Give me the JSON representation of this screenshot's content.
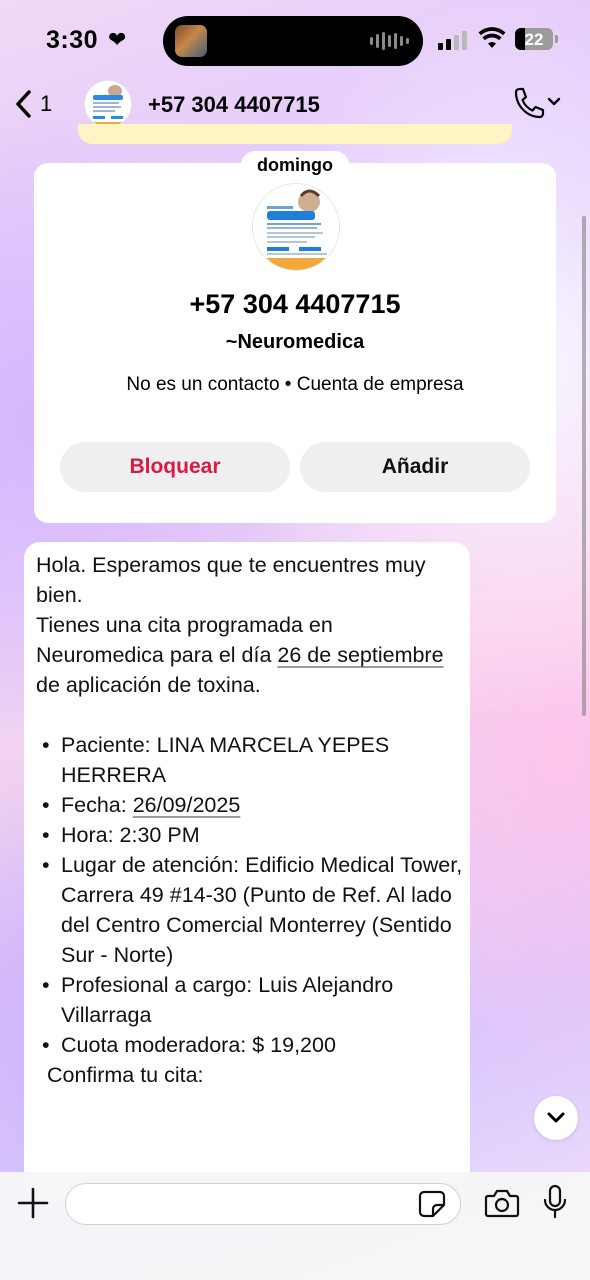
{
  "status_bar": {
    "time": "3:30",
    "battery": "22"
  },
  "header": {
    "back_count": "1",
    "title": "+57 304 4407715"
  },
  "date_label": "domingo",
  "contact_card": {
    "phone": "+57 304 4407715",
    "name": "~Neuromedica",
    "subtitle": "No es un contacto • Cuenta de empresa",
    "block_label": "Bloquear",
    "add_label": "Añadir"
  },
  "message": {
    "line1": "Hola. Esperamos que te encuentres muy bien.",
    "line2_pre": "Tienes una cita programada en Neuromedica para el día ",
    "line2_date": "26 de septiembre",
    "line2_post": " de aplicación de toxina.",
    "items": {
      "paciente": "Paciente:  LINA MARCELA YEPES HERRERA",
      "fecha_label": "Fecha: ",
      "fecha_value": "26/09/2025",
      "hora": "Hora: 2:30 PM",
      "lugar": "Lugar de atención: Edificio Medical Tower, Carrera 49 #14-30 (Punto de Ref. Al lado del Centro Comercial Monterrey (Sentido Sur - Norte)",
      "profesional": "Profesional a cargo: Luis Alejandro Villarraga",
      "cuota": "Cuota moderadora: $ 19,200"
    },
    "confirm": "Confirma tu cita:"
  },
  "colors": {
    "block": "#d81b42",
    "bubble": "#ffffff",
    "accent_logo": "#1f7fd8"
  }
}
